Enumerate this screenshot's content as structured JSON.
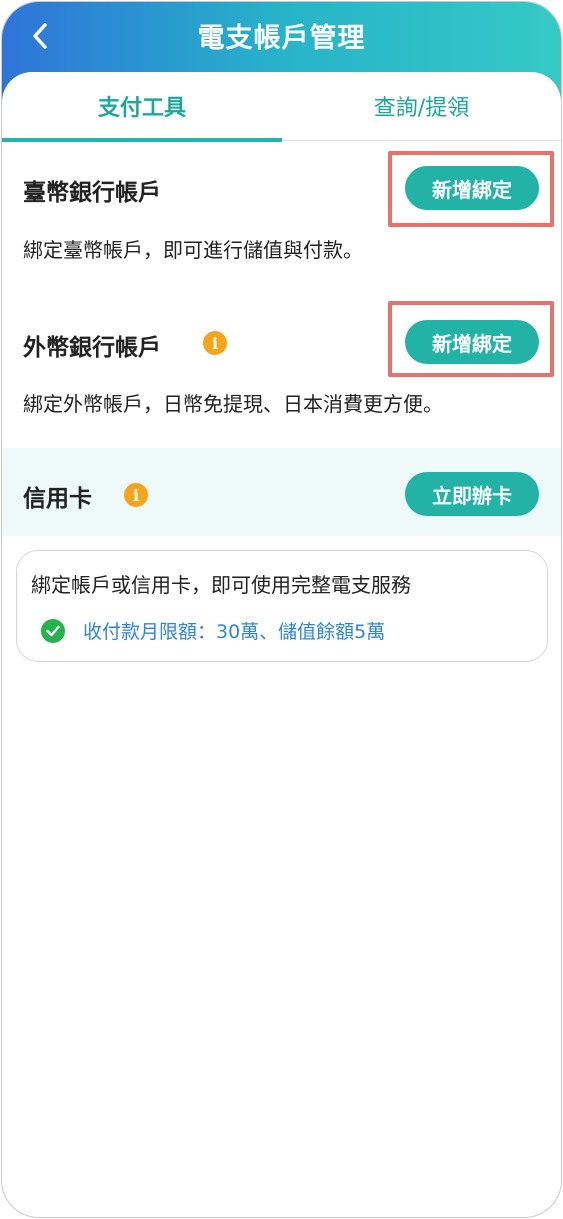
{
  "header": {
    "title": "電支帳戶管理"
  },
  "tabs": [
    {
      "label": "支付工具",
      "active": true
    },
    {
      "label": "查詢/提領",
      "active": false
    }
  ],
  "twd_account": {
    "title": "臺幣銀行帳戶",
    "button": "新增綁定",
    "description": "綁定臺幣帳戶，即可進行儲值與付款。"
  },
  "foreign_account": {
    "title": "外幣銀行帳戶",
    "info_icon": "i",
    "button": "新增綁定",
    "description": "綁定外幣帳戶，日幣免提現、日本消費更方便。"
  },
  "credit_card": {
    "title": "信用卡",
    "info_icon": "i",
    "button": "立即辦卡"
  },
  "notice_card": {
    "text": "綁定帳戶或信用卡，即可使用完整電支服務",
    "limit": "收付款月限額：30萬、儲值餘額5萬"
  },
  "colors": {
    "accent": "#22b3a6",
    "highlight": "#e8716b",
    "info": "#f4a51c",
    "link": "#2f86d8"
  }
}
